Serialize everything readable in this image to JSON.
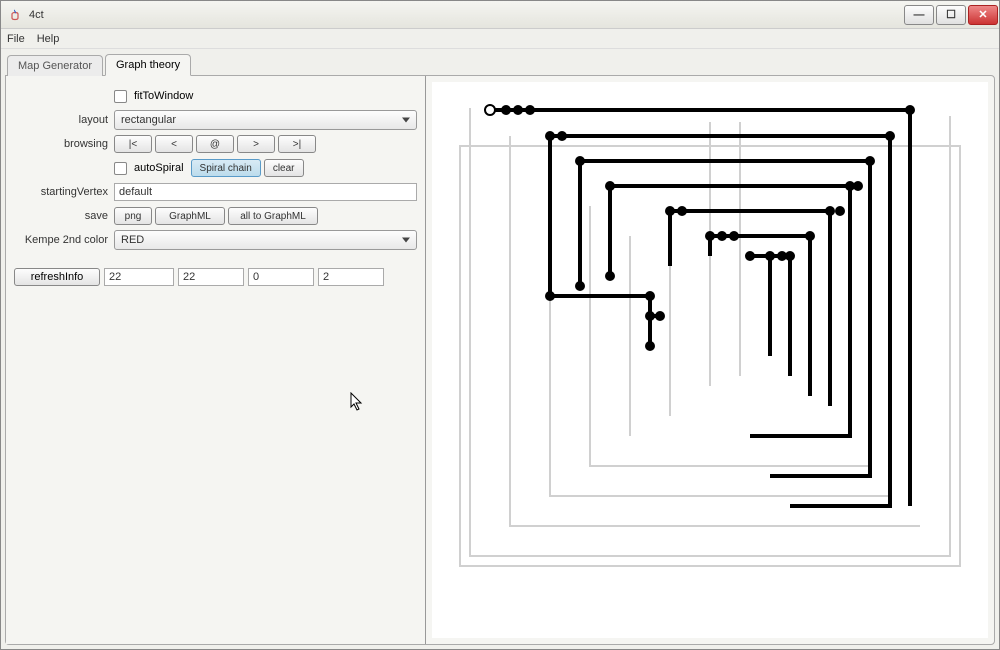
{
  "window": {
    "title": "4ct"
  },
  "menu": {
    "file": "File",
    "help": "Help"
  },
  "tabs": {
    "map_generator": "Map Generator",
    "graph_theory": "Graph theory"
  },
  "form": {
    "fitToWindow": "fitToWindow",
    "layout_label": "layout",
    "layout_value": "rectangular",
    "browsing_label": "browsing",
    "browse_first": "|<",
    "browse_prev": "<",
    "browse_at": "@",
    "browse_next": ">",
    "browse_last": ">|",
    "autoSpiral": "autoSpiral",
    "spiral_chain": "Spiral chain",
    "clear": "clear",
    "startingVertex_label": "startingVertex",
    "startingVertex_value": "default",
    "save_label": "save",
    "save_png": "png",
    "save_graphml": "GraphML",
    "save_all": "all to GraphML",
    "kempe_label": "Kempe 2nd color",
    "kempe_value": "RED",
    "refreshInfo": "refreshInfo",
    "info1": "22",
    "info2": "22",
    "info3": "0",
    "info4": "2"
  }
}
